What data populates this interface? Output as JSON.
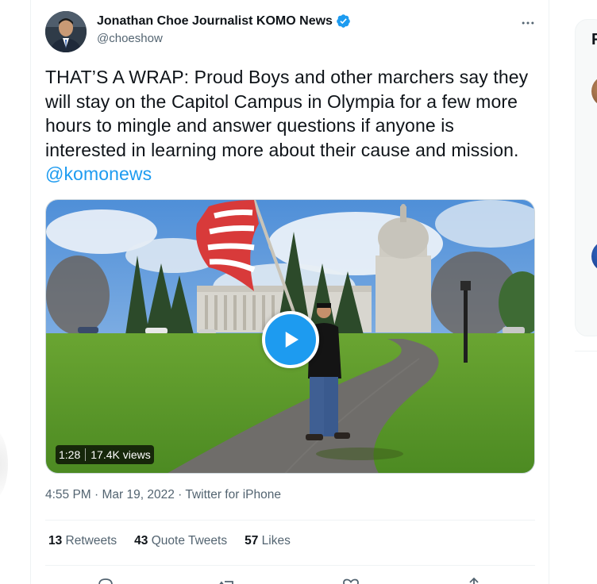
{
  "tweet": {
    "author": {
      "display_name": "Jonathan Choe Journalist KOMO News",
      "handle": "@choeshow",
      "verified": true
    },
    "text": "THAT’S A WRAP: Proud Boys and other marchers say they will stay on the Capitol Campus in Olympia for a few more hours to mingle and answer questions if anyone is interested in learning more about their cause and mission. ",
    "mention": "@komonews",
    "media": {
      "type": "video",
      "duration": "1:28",
      "views": "17.4K views"
    },
    "timestamp": {
      "time": "4:55 PM",
      "separator1": " · ",
      "date": "Mar 19, 2022",
      "separator2": " · ",
      "source": "Twitter for iPhone"
    },
    "stats": {
      "retweets_count": "13",
      "retweets_label": " Retweets",
      "quotes_count": "43",
      "quotes_label": " Quote Tweets",
      "likes_count": "57",
      "likes_label": " Likes"
    }
  },
  "sidebar": {
    "title_partial": "F"
  },
  "colors": {
    "accent": "#1d9bf0",
    "text": "#0f1419",
    "secondary_text": "#536471",
    "border": "#eff3f4"
  },
  "icons": [
    "verified-badge-icon",
    "more-icon",
    "play-icon",
    "reply-icon",
    "retweet-icon",
    "like-icon",
    "share-icon"
  ]
}
